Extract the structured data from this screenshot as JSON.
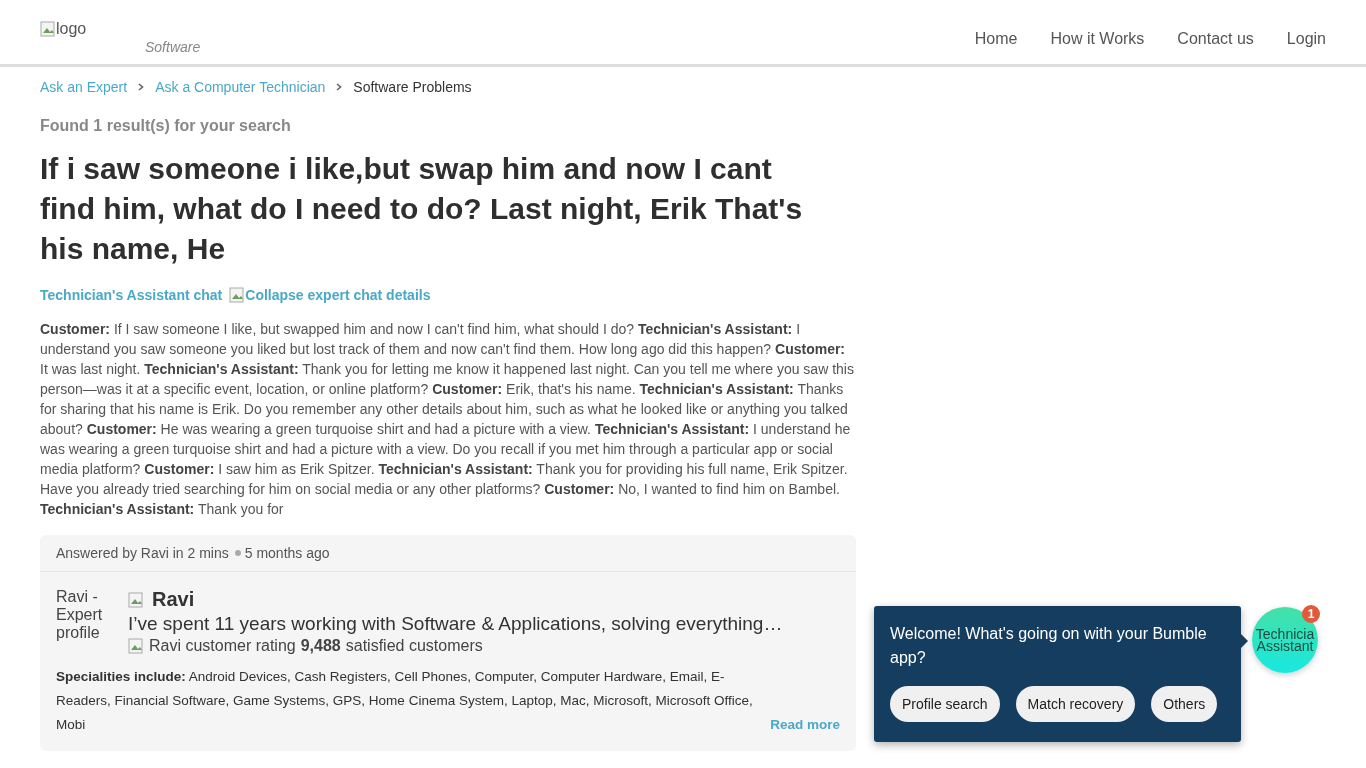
{
  "header": {
    "logo_alt": "logo",
    "tagline": "Software",
    "nav": [
      "Home",
      "How it Works",
      "Contact us",
      "Login"
    ]
  },
  "breadcrumbs": [
    {
      "label": "Ask an Expert",
      "kind": "link"
    },
    {
      "label": "Ask a Computer Technician",
      "kind": "link"
    },
    {
      "label": "Software Problems",
      "kind": "current"
    }
  ],
  "results_count": "Found 1 result(s) for your search",
  "question_title": "If i saw someone i like,but swap him and now I cant find him, what do I need to do? Last night, Erik That's his name, He",
  "chat_link": "Technician's Assistant chat",
  "collapse_alt": "Collapse expert chat details",
  "transcript": "**Customer:** If I saw someone I like, but swapped him and now I can't find him, what should I do? **Technician's Assistant:** I understand you saw someone you liked but lost track of them and now can't find them. How long ago did this happen? **Customer:** It was last night. **Technician's Assistant:** Thank you for letting me know it happened last night. Can you tell me where you saw this person—was it at a specific event, location, or online platform? **Customer:** Erik, that's his name. **Technician's Assistant:** Thanks for sharing that his name is Erik. Do you remember any other details about him, such as what he looked like or anything you talked about? **Customer:** He was wearing a green turquoise shirt and had a picture with a view. **Technician's Assistant:** I understand he was wearing a green turquoise shirt and had a picture with a view. Do you recall if you met him through a particular app or social media platform? **Customer:** I saw him as Erik Spitzer. **Technician's Assistant:** Thank you for providing his full name, Erik Spitzer. Have you already tried searching for him on social media or any other platforms? **Customer:** No, I wanted to find him on Bambel. **Technician's Assistant:** Thank you for",
  "answer": {
    "answered_by": "Answered by Ravi in 2 mins",
    "time_ago": "5 months ago",
    "profile_alt": "Ravi - Expert profile",
    "expert_name": "Ravi",
    "bio": "I’ve spent 11 years working with Software & Applications, solving everything…",
    "rating_alt": "Ravi customer rating",
    "satisfied_count": "9,488",
    "satisfied_label": "satisfied customers",
    "specialities": "**Specialities include:** Android Devices, Cash Registers, Cell Phones, Computer, Computer Hardware, Email, E-Readers, Financial Software, Game Systems, GPS, Home Cinema System, Laptop, Mac, Microsoft, Microsoft Office, Mobi",
    "read_more": "Read more"
  },
  "chat_popup": {
    "message": "Welcome! What's going on with your Bumble app?",
    "options": [
      "Profile search",
      "Match recovery",
      "Others"
    ],
    "avatar_alt_lines": [
      "Technicia",
      "Assistant"
    ],
    "badge": "1"
  }
}
